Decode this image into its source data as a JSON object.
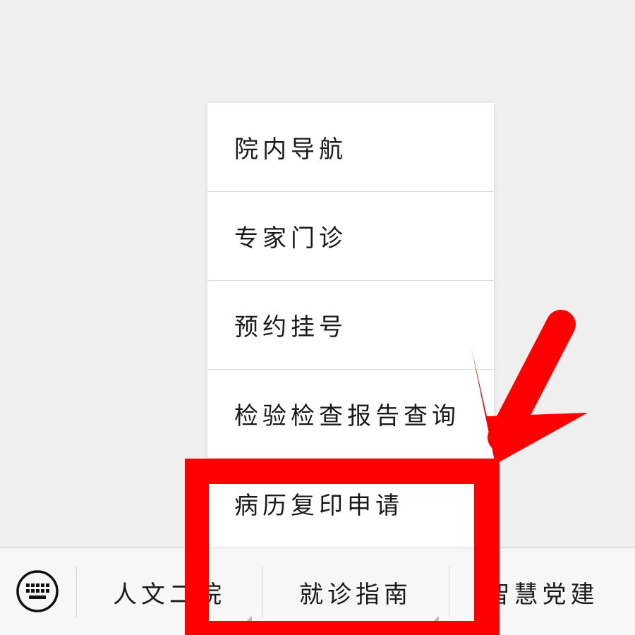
{
  "popup_menu": {
    "items": [
      {
        "label": "院内导航"
      },
      {
        "label": "专家门诊"
      },
      {
        "label": "预约挂号"
      },
      {
        "label": "检验检查报告查询"
      },
      {
        "label": "病历复印申请"
      }
    ]
  },
  "bottom_bar": {
    "keyboard_icon": "keyboard-icon",
    "tabs": [
      {
        "label": "人文二院"
      },
      {
        "label": "就诊指南"
      },
      {
        "label": "智慧党建"
      }
    ]
  },
  "annotation": {
    "color": "#ff0000",
    "shapes": [
      "highlight-box",
      "arrow"
    ]
  }
}
